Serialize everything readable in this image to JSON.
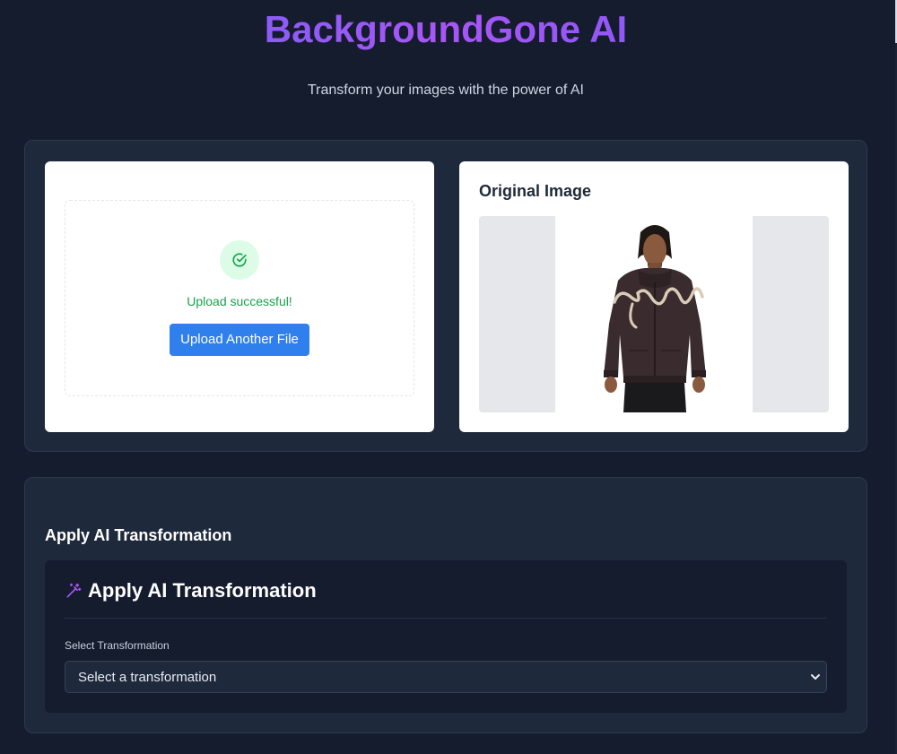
{
  "header": {
    "title": "BackgroundGone AI",
    "subtitle": "Transform your images with the power of AI"
  },
  "upload": {
    "status_icon": "check-circle-icon",
    "status_text": "Upload successful!",
    "button_label": "Upload Another File"
  },
  "original": {
    "title": "Original Image"
  },
  "transformation_section": {
    "heading": "Apply AI Transformation",
    "card_title": "Apply AI Transformation",
    "card_icon": "magic-wand-icon",
    "select_label": "Select Transformation",
    "select_value": "Select a transformation"
  },
  "colors": {
    "background": "#141c2e",
    "panel": "#1e293b",
    "accent_blue": "#2f80ed",
    "success_green": "#16a34a",
    "title_gradient_start": "#6366f1",
    "title_gradient_end": "#a855f7"
  }
}
